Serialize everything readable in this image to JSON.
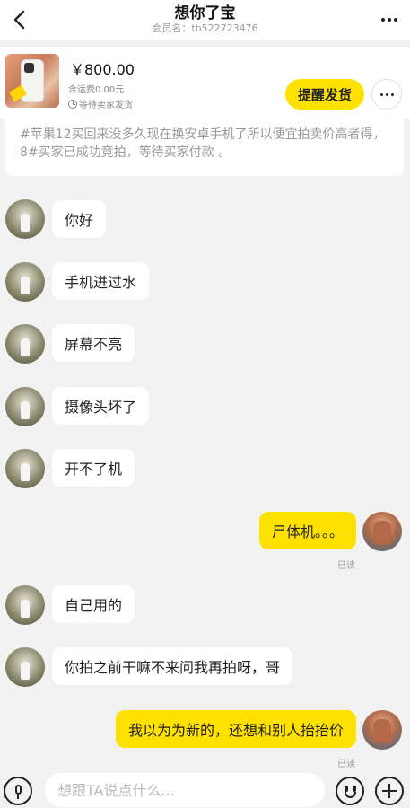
{
  "header": {
    "title": "想你了宝",
    "subtitle": "会员名：tb522723476",
    "back_icon": "chevron-left-icon",
    "more_icon": "more-horizontal-icon"
  },
  "product": {
    "price": "￥800.00",
    "shipping": "含运费0.00元",
    "status": "等待卖家发货",
    "remind_label": "提醒发货",
    "accent_color": "#ffe100"
  },
  "system_message": "#苹果12买回来没多久现在换安卓手机了所以便宜拍卖价高者得，8#买家已成功竞拍，等待买家付款 。",
  "messages": [
    {
      "side": "left",
      "text": "你好"
    },
    {
      "side": "left",
      "text": "手机进过水"
    },
    {
      "side": "left",
      "text": "屏幕不亮"
    },
    {
      "side": "left",
      "text": "摄像头坏了"
    },
    {
      "side": "left",
      "text": "开不了机"
    },
    {
      "side": "right",
      "text": "尸体机。。。",
      "status": "已读"
    },
    {
      "side": "left",
      "text": "自己用的"
    },
    {
      "side": "left",
      "text": "你拍之前干嘛不来问我再拍呀，哥"
    },
    {
      "side": "right",
      "text": "我以为为新的，还想和别人抬抬价",
      "status": "已读"
    }
  ],
  "input_bar": {
    "placeholder": "想跟TA说点什么...",
    "voice_icon": "microphone-icon",
    "emoji_icon": "emoji-icon",
    "plus_icon": "plus-icon"
  }
}
